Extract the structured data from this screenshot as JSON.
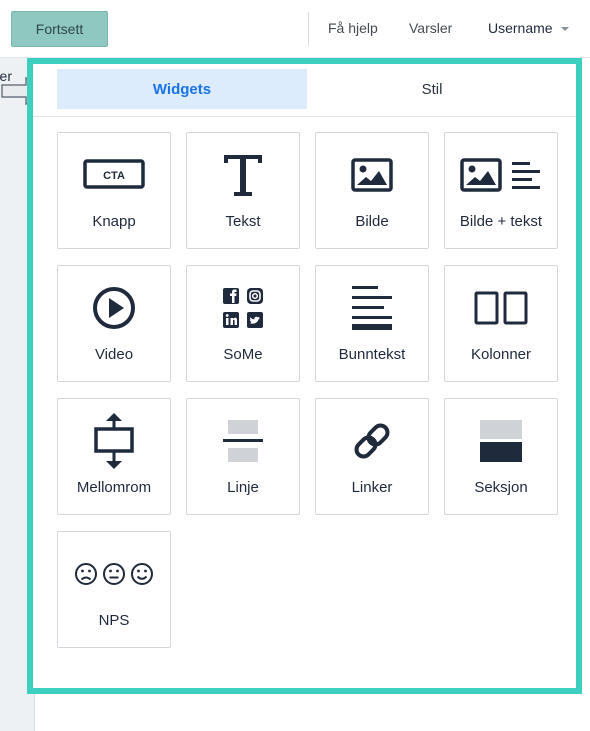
{
  "topbar": {
    "continue_label": "Fortsett",
    "help_label": "Få hjelp",
    "notifications_label": "Varsler",
    "user_label": "Username"
  },
  "left_strip": {
    "partial_text": "er"
  },
  "tabs": [
    {
      "label": "Widgets",
      "active": true
    },
    {
      "label": "Stil",
      "active": false
    }
  ],
  "widgets": [
    {
      "label": "Knapp",
      "icon": "cta-button-icon",
      "icon_text": "CTA"
    },
    {
      "label": "Tekst",
      "icon": "text-icon"
    },
    {
      "label": "Bilde",
      "icon": "image-icon"
    },
    {
      "label": "Bilde + tekst",
      "icon": "image-text-icon"
    },
    {
      "label": "Video",
      "icon": "video-play-icon"
    },
    {
      "label": "SoMe",
      "icon": "social-media-icon"
    },
    {
      "label": "Bunntekst",
      "icon": "footer-icon"
    },
    {
      "label": "Kolonner",
      "icon": "columns-icon"
    },
    {
      "label": "Mellomrom",
      "icon": "spacer-icon"
    },
    {
      "label": "Linje",
      "icon": "divider-line-icon"
    },
    {
      "label": "Linker",
      "icon": "link-icon"
    },
    {
      "label": "Seksjon",
      "icon": "section-icon"
    },
    {
      "label": "NPS",
      "icon": "nps-faces-icon"
    }
  ],
  "colors": {
    "accent_border": "#3dd0c0",
    "active_tab_bg": "#dcecfd",
    "active_tab_text": "#1a73e8",
    "icon_dark": "#1f2a3c",
    "continue_button": "#8fc7c1"
  }
}
